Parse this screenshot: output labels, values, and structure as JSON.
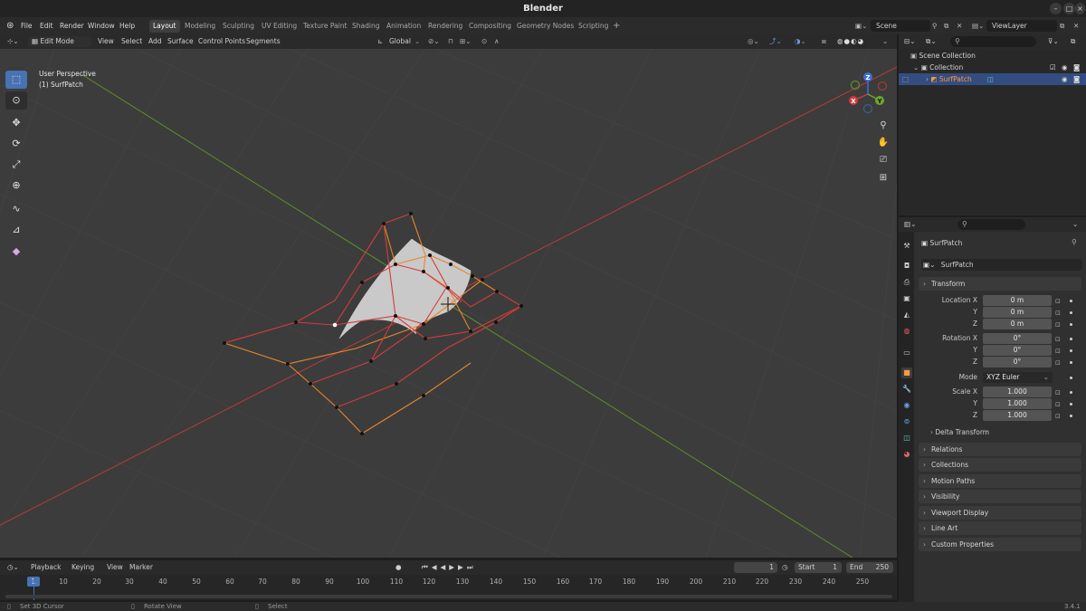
{
  "window": {
    "title": "Blender"
  },
  "menu": [
    "File",
    "Edit",
    "Render",
    "Window",
    "Help"
  ],
  "workspaces": [
    "Layout",
    "Modeling",
    "Sculpting",
    "UV Editing",
    "Texture Paint",
    "Shading",
    "Animation",
    "Rendering",
    "Compositing",
    "Geometry Nodes",
    "Scripting"
  ],
  "active_workspace": "Layout",
  "scene": {
    "name": "Scene",
    "view_layer": "ViewLayer"
  },
  "viewport_header": {
    "mode": "Edit Mode",
    "menus": [
      "View",
      "Select",
      "Add",
      "Surface",
      "Control Points",
      "Segments"
    ],
    "transform_orientation": "Global"
  },
  "viewport": {
    "perspective_label": "User Perspective",
    "object_label": "(1) SurfPatch"
  },
  "gizmo": {
    "x": "X",
    "y": "Y",
    "z": "Z"
  },
  "outliner": {
    "items": [
      {
        "label": "Scene Collection"
      },
      {
        "label": "Collection"
      },
      {
        "label": "SurfPatch"
      }
    ]
  },
  "properties": {
    "object_name": "SurfPatch",
    "datablock_name": "SurfPatch",
    "transform_title": "Transform",
    "location": {
      "label": "Location X",
      "x": "0 m",
      "y": "0 m",
      "z": "0 m"
    },
    "rotation": {
      "label": "Rotation X",
      "x": "0°",
      "y": "0°",
      "z": "0°"
    },
    "mode": {
      "label": "Mode",
      "value": "XYZ Euler"
    },
    "scale": {
      "label": "Scale X",
      "x": "1.000",
      "y": "1.000",
      "z": "1.000"
    },
    "axis_y": "Y",
    "axis_z": "Z",
    "delta_transform": "Delta Transform",
    "panels": [
      "Relations",
      "Collections",
      "Motion Paths",
      "Visibility",
      "Viewport Display",
      "Line Art",
      "Custom Properties"
    ]
  },
  "timeline": {
    "menus": [
      "Playback",
      "Keying",
      "View",
      "Marker"
    ],
    "current_frame": "1",
    "start_label": "Start",
    "start": "1",
    "end_label": "End",
    "end": "250",
    "ticks": [
      "1",
      "10",
      "20",
      "30",
      "40",
      "50",
      "60",
      "70",
      "80",
      "90",
      "100",
      "110",
      "120",
      "130",
      "140",
      "150",
      "160",
      "170",
      "180",
      "190",
      "200",
      "210",
      "220",
      "230",
      "240",
      "250"
    ]
  },
  "statusbar": {
    "left": "Set 3D Cursor",
    "middle": "Rotate View",
    "right": "Select",
    "version": "3.4.1"
  },
  "colors": {
    "accent": "#4772b3",
    "selected_object": "#ff9a3c",
    "viewport_bg": "#3c3c3c",
    "x_axis": "#c93a3a",
    "y_axis": "#6fa52d"
  }
}
